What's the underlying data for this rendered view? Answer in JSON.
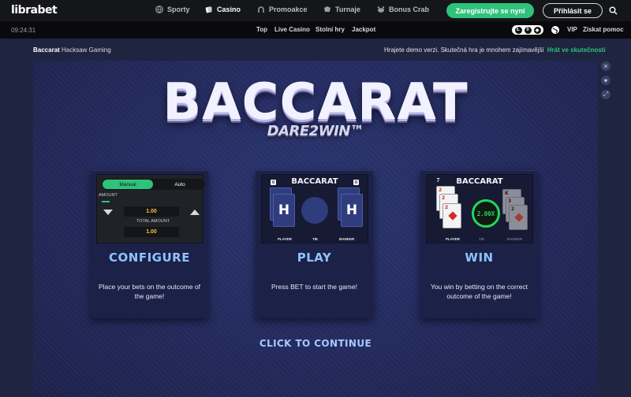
{
  "site": {
    "logo": "librabet"
  },
  "topnav": {
    "items": [
      {
        "label": "Sporty",
        "icon": "globe-ball-icon"
      },
      {
        "label": "Casino",
        "icon": "cards-icon"
      },
      {
        "label": "Promoakce",
        "icon": "horseshoe-icon"
      },
      {
        "label": "Turnaje",
        "icon": "trophy-icon"
      },
      {
        "label": "Bonus Crab",
        "icon": "crab-icon"
      }
    ],
    "register_label": "Zaregistrujte se nyní",
    "login_label": "Přihlásit se"
  },
  "subnav": {
    "clock": "09:24:31",
    "items": [
      "Top",
      "Live Casino",
      "Stolní hry",
      "Jackpot"
    ],
    "vip_label": "VIP",
    "help_label": "Získat pomoc"
  },
  "breadcrumb": {
    "game": "Baccarat",
    "provider": "Hacksaw Gaming",
    "demo_notice": "Hrajete demo verzi. Skutečná hra je mnohem zajímavější",
    "demo_link": "Hrát ve skutečnosti"
  },
  "game": {
    "logo_title": "BACCARAT",
    "logo_subtitle": "DARE2WIN™",
    "cta": "CLICK TO CONTINUE",
    "cards": [
      {
        "title": "CONFIGURE",
        "description": "Place your bets on the outcome of the game!",
        "preview": {
          "manual_label": "Manual",
          "auto_label": "Auto",
          "amount_label": "AMOUNT",
          "amount_value": "1.00",
          "total_label": "TOTAL AMOUNT",
          "total_value": "1.00"
        }
      },
      {
        "title": "PLAY",
        "description": "Press BET to start the game!",
        "preview": {
          "title": "BACCARAT",
          "card_letter": "H",
          "left_count": "0",
          "right_count": "0",
          "labels": [
            "PLAYER",
            "TIE",
            "BANKER"
          ]
        }
      },
      {
        "title": "WIN",
        "description": "You win by betting on the correct outcome of the game!",
        "preview": {
          "title": "BACCARAT",
          "left_count": "7",
          "multiplier": "2.00X",
          "labels": [
            "PLAYER",
            "TIE",
            "BANKER"
          ],
          "card_ranks_left": [
            "2",
            "2",
            "2"
          ],
          "card_ranks_right": [
            "K",
            "3",
            "2"
          ]
        }
      }
    ]
  },
  "colors": {
    "accent": "#2fc27a",
    "title_blue": "#8fc3ff",
    "bg": "#1f2440"
  }
}
